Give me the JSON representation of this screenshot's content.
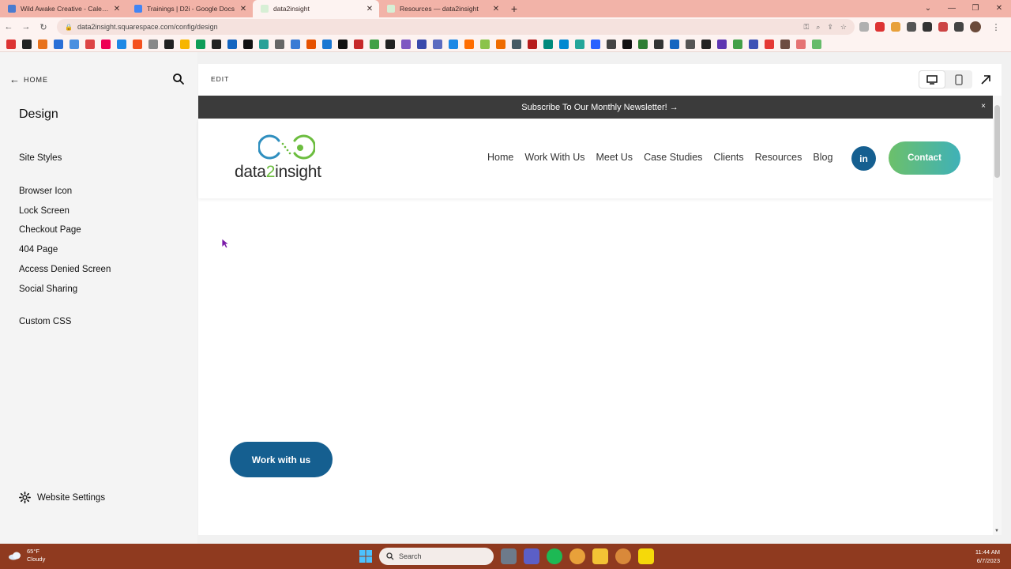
{
  "browser": {
    "tabs": [
      {
        "title": "Wild Awake Creative - Calendar -",
        "color": "#4a7bd0"
      },
      {
        "title": "Trainings | D2i - Google Docs",
        "color": "#4285f4"
      },
      {
        "title": "data2insight",
        "color": "#7bc67a"
      },
      {
        "title": "Resources — data2insight",
        "color": "#7bc67a"
      }
    ],
    "new_tab": "+",
    "url": "data2insight.squarespace.com/config/design"
  },
  "panel": {
    "home": "HOME",
    "title": "Design",
    "items": [
      "Site Styles",
      "Browser Icon",
      "Lock Screen",
      "Checkout Page",
      "404 Page",
      "Access Denied Screen",
      "Social Sharing",
      "Custom CSS"
    ],
    "settings": "Website Settings"
  },
  "editor": {
    "edit_label": "EDIT"
  },
  "site": {
    "announcement": "Subscribe To Our Monthly Newsletter! →",
    "announcement_close": "×",
    "logo_pre": "data",
    "logo_two": "2",
    "logo_post": "insight",
    "nav": [
      "Home",
      "Work With Us",
      "Meet Us",
      "Case Studies",
      "Clients",
      "Resources",
      "Blog"
    ],
    "linkedin": "in",
    "contact": "Contact",
    "cta": "Work with us",
    "brand_blue": "#155f90",
    "brand_green": "#6cbd3f"
  },
  "taskbar": {
    "temp": "65°F",
    "condition": "Cloudy",
    "search_placeholder": "Search",
    "time": "11:44 AM",
    "date": "6/7/2023"
  }
}
